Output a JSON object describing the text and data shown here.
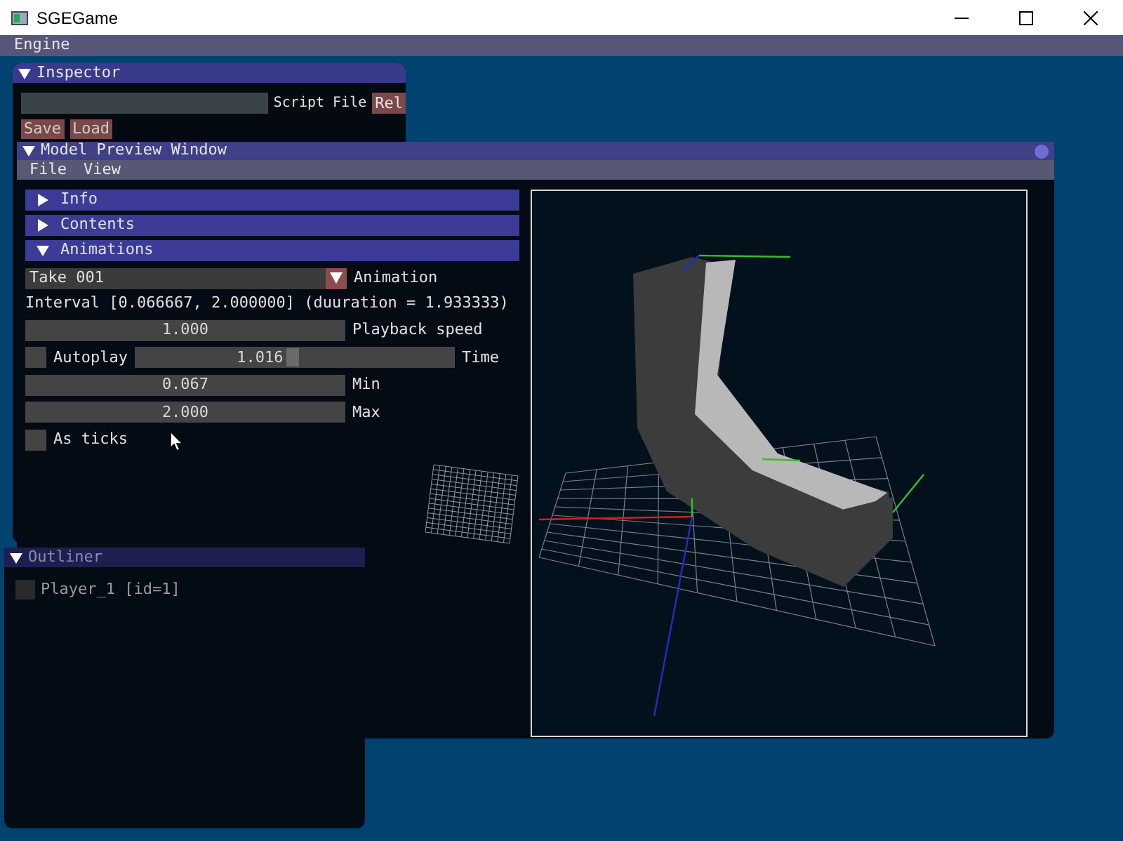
{
  "window": {
    "title": "SGEGame"
  },
  "menu_bar": [
    "Engine"
  ],
  "inspector": {
    "title": "Inspector",
    "expanded": true,
    "script_file": {
      "label": "Script File"
    },
    "reload_button": "Rel",
    "buttons": [
      "Save",
      "Load"
    ]
  },
  "outliner": {
    "title": "Outliner",
    "expanded": true,
    "items": [
      {
        "label": "Player_1 [id=1]",
        "checked": false
      }
    ]
  },
  "model_preview": {
    "title": "Model Preview Window",
    "menu": [
      "File",
      "View"
    ],
    "sections": [
      {
        "label": "Info",
        "expanded": false
      },
      {
        "label": "Contents",
        "expanded": false
      },
      {
        "label": "Animations",
        "expanded": true
      }
    ],
    "animation": {
      "value": "Take 001",
      "label": "Animation"
    },
    "interval": "Interval [0.066667, 2.000000] (duuration = 1.933333)",
    "rows": [
      {
        "kind": "slider",
        "value": "1.000",
        "label": "Playback speed"
      },
      {
        "kind": "checkbox_slider",
        "checkbox_label": "Autoplay",
        "checked": false,
        "value": "1.016",
        "level": 0.49,
        "label": "Time"
      },
      {
        "kind": "slider",
        "value": "0.067",
        "label": "Min"
      },
      {
        "kind": "slider",
        "value": "2.000",
        "label": "Max"
      },
      {
        "kind": "checkbox",
        "checkbox_label": "As ticks",
        "checked": false
      }
    ]
  }
}
